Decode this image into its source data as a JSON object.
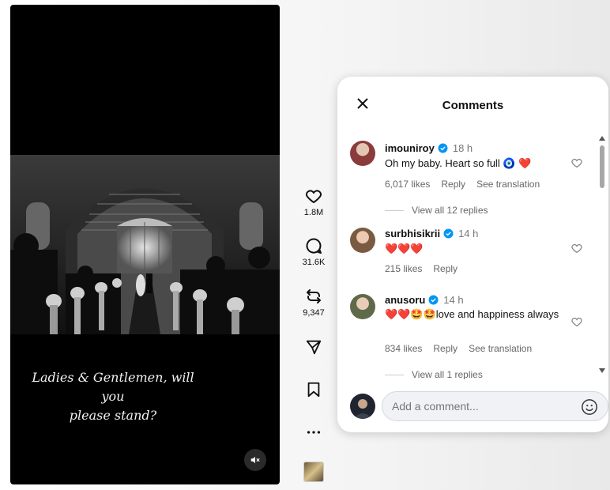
{
  "video": {
    "caption_line1": "Ladies & Gentlemen, will you",
    "caption_line2": "please stand?"
  },
  "rail": {
    "like_count": "1.8M",
    "comment_count": "31.6K",
    "repost_count": "9,347"
  },
  "panel": {
    "title": "Comments",
    "comments": [
      {
        "user": "imouniroy",
        "time": "18 h",
        "text": "Oh my baby. Heart so full 🧿 ❤️",
        "likes": "6,017 likes",
        "reply": "Reply",
        "translate": "See translation",
        "view_replies": "View all 12 replies"
      },
      {
        "user": "surbhisikrii",
        "time": "14 h",
        "text": "❤️❤️❤️",
        "likes": "215 likes",
        "reply": "Reply"
      },
      {
        "user": "anusoru",
        "time": "14 h",
        "text": "❤️❤️🤩🤩love and happiness always",
        "likes": "834 likes",
        "reply": "Reply",
        "translate": "See translation",
        "view_replies": "View all 1 replies"
      }
    ],
    "input_placeholder": "Add a comment..."
  },
  "colors": {
    "verified": "#0095f6",
    "heart_red": "#e0245e",
    "panel_bg": "#ffffff"
  },
  "icons": [
    "heart-icon",
    "comment-icon",
    "repost-icon",
    "share-icon",
    "bookmark-icon",
    "more-icon",
    "mute-icon",
    "close-icon",
    "verified-icon",
    "emoji-icon"
  ]
}
